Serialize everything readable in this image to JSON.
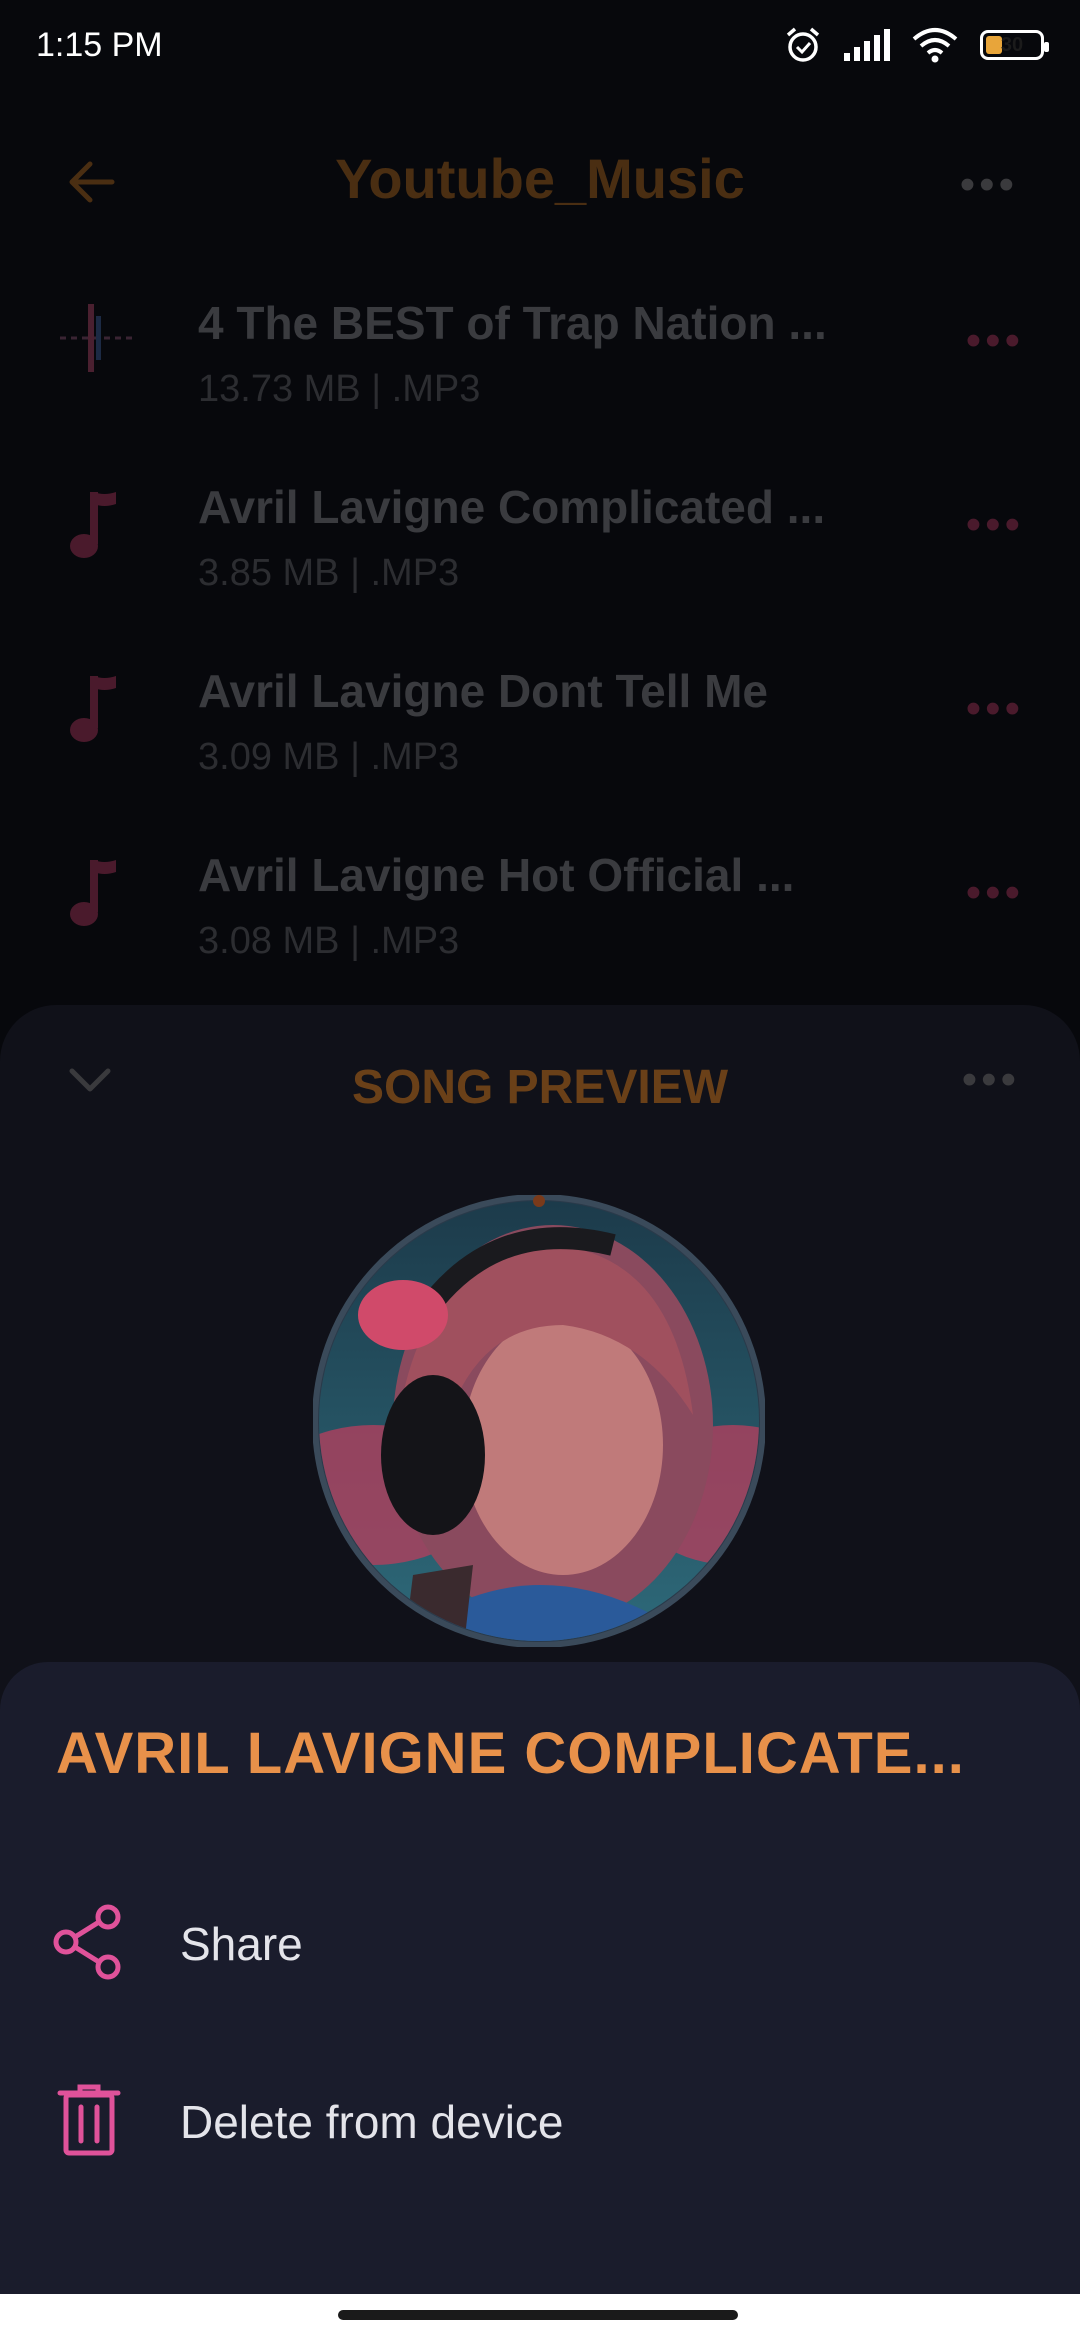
{
  "status_bar": {
    "time": "1:15 PM",
    "battery": "30"
  },
  "header": {
    "title": "Youtube_Music"
  },
  "songs": [
    {
      "title": "4 The BEST of Trap Nation ...",
      "meta": "13.73 MB  |  .MP3",
      "icon": "waveform-icon"
    },
    {
      "title": "Avril Lavigne  Complicated ...",
      "meta": "3.85 MB  |  .MP3",
      "icon": "music-note-icon"
    },
    {
      "title": "Avril Lavigne  Dont Tell Me",
      "meta": "3.09 MB  |  .MP3",
      "icon": "music-note-icon"
    },
    {
      "title": "Avril Lavigne  Hot Official ...",
      "meta": "3.08 MB  |  .MP3",
      "icon": "music-note-icon"
    }
  ],
  "preview": {
    "title": "SONG PREVIEW"
  },
  "menu": {
    "title": "AVRIL LAVIGNE  COMPLICATE...",
    "share_label": "Share",
    "delete_label": "Delete from device"
  },
  "colors": {
    "accent_orange": "#e8914a",
    "accent_pink": "#e0529a",
    "sheet_bg": "#1a1c2c"
  }
}
